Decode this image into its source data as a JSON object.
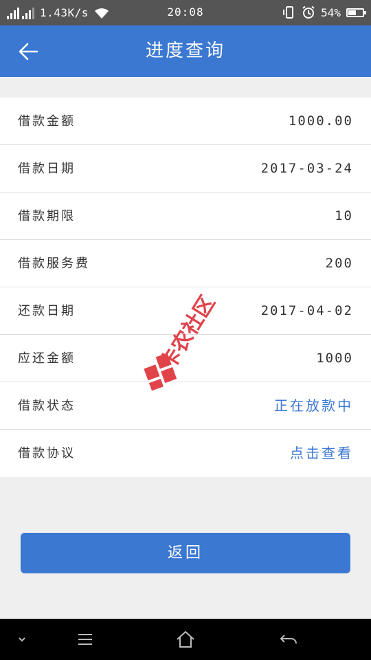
{
  "status_bar": {
    "net_speed": "1.43K/s",
    "time": "20:08",
    "battery": "54%",
    "battery_level": 0.54,
    "icons": [
      "signal-icon",
      "signal-icon",
      "wifi-icon",
      "vibrate-icon",
      "alarm-icon",
      "battery-icon"
    ]
  },
  "header": {
    "title": "进度查询",
    "back_icon": "arrow-left-icon"
  },
  "details": {
    "loan_amount": {
      "label": "借款金额",
      "value": "1000.00"
    },
    "loan_date": {
      "label": "借款日期",
      "value": "2017-03-24"
    },
    "loan_term": {
      "label": "借款期限",
      "value": "10"
    },
    "service_fee": {
      "label": "借款服务费",
      "value": "200"
    },
    "repay_date": {
      "label": "还款日期",
      "value": "2017-04-02"
    },
    "repay_amount": {
      "label": "应还金额",
      "value": "1000"
    },
    "loan_status": {
      "label": "借款状态",
      "value": "正在放款中"
    },
    "loan_agreement": {
      "label": "借款协议",
      "value": "点击查看"
    }
  },
  "actions": {
    "return_label": "返回"
  },
  "watermark": {
    "text": "卡农社区"
  },
  "nav_bar": {
    "icons": [
      "chevron-down-icon",
      "menu-icon",
      "home-icon",
      "back-icon"
    ]
  },
  "colors": {
    "accent": "#3b78d2",
    "status_bar": "#555555",
    "background": "#efefef",
    "watermark": "#e0434a"
  }
}
